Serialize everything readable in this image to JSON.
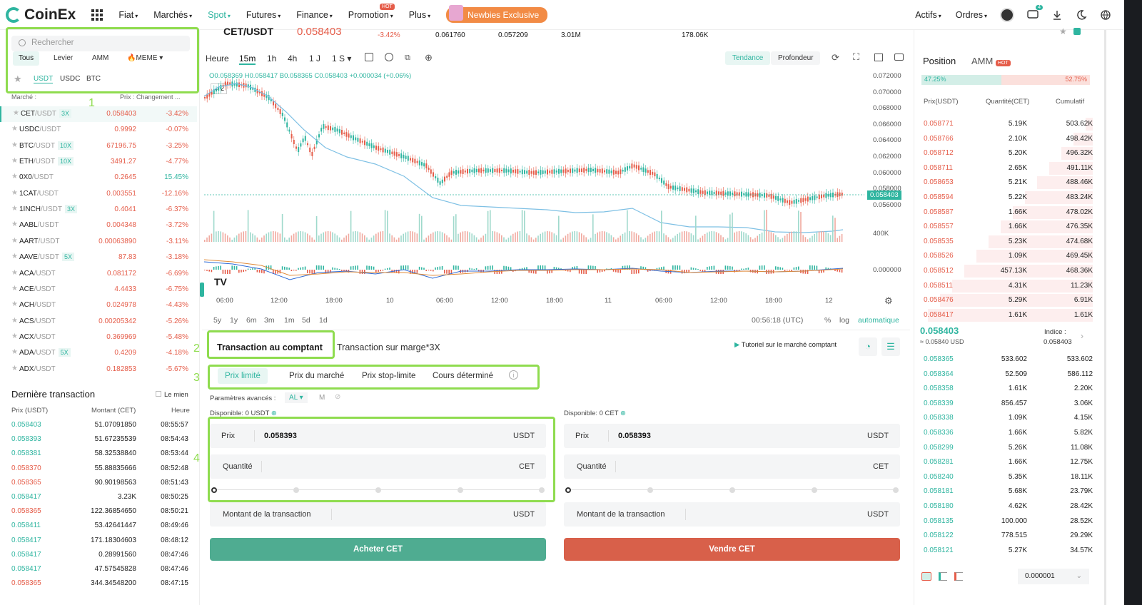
{
  "nav": {
    "brand": "CoinEx",
    "items": [
      "Fiat",
      "Marchés",
      "Spot",
      "Futures",
      "Finance",
      "Promotion",
      "Plus"
    ],
    "hot": "HOT",
    "newbie": "Newbies Exclusive",
    "actifs": "Actifs",
    "ordres": "Ordres",
    "msg_count": "4",
    "accent": "#2fb5a0"
  },
  "ticker": {
    "pair": "CET/USDT",
    "price": "0.058403",
    "change": "-3.42%",
    "high": "0.061760",
    "low": "0.057209",
    "vol": "3.01M",
    "amount": "178.06K"
  },
  "left": {
    "search_placeholder": "Rechercher",
    "filters": [
      "Tous",
      "Levier",
      "AMM",
      "MEME"
    ],
    "quotes": [
      "USDT",
      "USDC",
      "BTC"
    ],
    "col_market": "Marché :",
    "col_price": "Prix : Changement ...",
    "markets": [
      {
        "base": "CET",
        "quote": "/USDT",
        "lev": "3X",
        "price": "0.058403",
        "chg": "-3.42%",
        "neg": true
      },
      {
        "base": "USDC",
        "quote": "/USDT",
        "lev": "",
        "price": "0.9992",
        "chg": "-0.07%",
        "neg": true
      },
      {
        "base": "BTC",
        "quote": "/USDT",
        "lev": "10X",
        "price": "67196.75",
        "chg": "-3.25%",
        "neg": true
      },
      {
        "base": "ETH",
        "quote": "/USDT",
        "lev": "10X",
        "price": "3491.27",
        "chg": "-4.77%",
        "neg": true
      },
      {
        "base": "0X0",
        "quote": "/USDT",
        "lev": "",
        "price": "0.2645",
        "chg": "15.45%",
        "neg": false
      },
      {
        "base": "1CAT",
        "quote": "/USDT",
        "lev": "",
        "price": "0.003551",
        "chg": "-12.16%",
        "neg": true
      },
      {
        "base": "1INCH",
        "quote": "/USDT",
        "lev": "3X",
        "price": "0.4041",
        "chg": "-6.37%",
        "neg": true
      },
      {
        "base": "AABL",
        "quote": "/USDT",
        "lev": "",
        "price": "0.004348",
        "chg": "-3.72%",
        "neg": true
      },
      {
        "base": "AART",
        "quote": "/USDT",
        "lev": "",
        "price": "0.00063890",
        "chg": "-3.11%",
        "neg": true
      },
      {
        "base": "AAVE",
        "quote": "/USDT",
        "lev": "5X",
        "price": "87.83",
        "chg": "-3.18%",
        "neg": true
      },
      {
        "base": "ACA",
        "quote": "/USDT",
        "lev": "",
        "price": "0.081172",
        "chg": "-6.69%",
        "neg": true
      },
      {
        "base": "ACE",
        "quote": "/USDT",
        "lev": "",
        "price": "4.4433",
        "chg": "-6.75%",
        "neg": true
      },
      {
        "base": "ACH",
        "quote": "/USDT",
        "lev": "",
        "price": "0.024978",
        "chg": "-4.43%",
        "neg": true
      },
      {
        "base": "ACS",
        "quote": "/USDT",
        "lev": "",
        "price": "0.00205342",
        "chg": "-5.26%",
        "neg": true
      },
      {
        "base": "ACX",
        "quote": "/USDT",
        "lev": "",
        "price": "0.369969",
        "chg": "-5.48%",
        "neg": true
      },
      {
        "base": "ADA",
        "quote": "/USDT",
        "lev": "5X",
        "price": "0.4209",
        "chg": "-4.18%",
        "neg": true
      },
      {
        "base": "ADX",
        "quote": "/USDT",
        "lev": "",
        "price": "0.182853",
        "chg": "-5.67%",
        "neg": true
      }
    ],
    "last_title": "Dernière transaction",
    "mine": "Le mien",
    "th_price": "Prix (USDT)",
    "th_amount": "Montant (CET)",
    "th_time": "Heure",
    "trades": [
      {
        "p": "0.058403",
        "a": "51.07091850",
        "t": "08:55:57",
        "buy": true
      },
      {
        "p": "0.058393",
        "a": "51.67235539",
        "t": "08:54:43",
        "buy": true
      },
      {
        "p": "0.058381",
        "a": "58.32538840",
        "t": "08:53:44",
        "buy": true
      },
      {
        "p": "0.058370",
        "a": "55.88835666",
        "t": "08:52:48",
        "buy": false
      },
      {
        "p": "0.058365",
        "a": "90.90198563",
        "t": "08:51:43",
        "buy": false
      },
      {
        "p": "0.058417",
        "a": "3.23K",
        "t": "08:50:25",
        "buy": true
      },
      {
        "p": "0.058365",
        "a": "122.36854650",
        "t": "08:50:21",
        "buy": false
      },
      {
        "p": "0.058411",
        "a": "53.42641447",
        "t": "08:49:46",
        "buy": true
      },
      {
        "p": "0.058417",
        "a": "171.18304603",
        "t": "08:48:12",
        "buy": true
      },
      {
        "p": "0.058417",
        "a": "0.28991560",
        "t": "08:47:46",
        "buy": true
      },
      {
        "p": "0.058417",
        "a": "47.57545828",
        "t": "08:47:46",
        "buy": true
      },
      {
        "p": "0.058365",
        "a": "344.34548200",
        "t": "08:47:15",
        "buy": false
      }
    ]
  },
  "chart": {
    "intervals": [
      "Heure",
      "15m",
      "1h",
      "4h",
      "1 J",
      "1 S"
    ],
    "modes": [
      "Tendance",
      "Profondeur"
    ],
    "ohlc": "O0.058369 H0.058417 B0.058365 C0.058403 +0.000034 (+0.06%)",
    "collapse": "2",
    "ylabels": [
      "0.072000",
      "0.070000",
      "0.068000",
      "0.066000",
      "0.064000",
      "0.062000",
      "0.060000",
      "0.058000",
      "0.056000"
    ],
    "last": "0.058403",
    "vol_label": "400K",
    "macd_label": "0.000000",
    "xlabels": [
      "06:00",
      "12:00",
      "18:00",
      "10",
      "06:00",
      "12:00",
      "18:00",
      "11",
      "06:00",
      "12:00",
      "18:00",
      "12"
    ],
    "ranges": [
      "5y",
      "1y",
      "6m",
      "3m",
      "1m",
      "5d",
      "1d"
    ],
    "clock": "00:56:18 (UTC)",
    "pct": "%",
    "log": "log",
    "auto": "automatique"
  },
  "trade": {
    "tab_spot": "Transaction au comptant",
    "tab_margin": "Transaction sur marge*3X",
    "tutorial": "Tutoriel sur le marché comptant",
    "otypes": [
      "Prix limité",
      "Prix du marché",
      "Prix stop-limite",
      "Cours déterminé"
    ],
    "adv": "Paramètres avancés :",
    "al": "AL",
    "m": "M",
    "avail_buy": "Disponible: 0 USDT",
    "avail_sell": "Disponible: 0 CET",
    "prix": "Prix",
    "price_val": "0.058393",
    "usdt": "USDT",
    "cet": "CET",
    "qty": "Quantité",
    "montant": "Montant de la transaction",
    "buy_btn": "Acheter CET",
    "sell_btn": "Vendre CET",
    "buy_color": "#4fac91",
    "sell_color": "#d8604a"
  },
  "ob": {
    "tab_pos": "Position",
    "tab_amm": "AMM",
    "hot": "HOT",
    "buy_pct": "47.25%",
    "sell_pct": "52.75%",
    "h_price": "Prix(USDT)",
    "h_qty": "Quantité(CET)",
    "h_cum": "Cumulatif",
    "asks": [
      [
        "0.058771",
        "5.19K",
        "503.62K"
      ],
      [
        "0.058766",
        "2.10K",
        "498.42K"
      ],
      [
        "0.058712",
        "5.20K",
        "496.32K"
      ],
      [
        "0.058711",
        "2.65K",
        "491.11K"
      ],
      [
        "0.058653",
        "5.21K",
        "488.46K"
      ],
      [
        "0.058594",
        "5.22K",
        "483.24K"
      ],
      [
        "0.058587",
        "1.66K",
        "478.02K"
      ],
      [
        "0.058557",
        "1.66K",
        "476.35K"
      ],
      [
        "0.058535",
        "5.23K",
        "474.68K"
      ],
      [
        "0.058526",
        "1.09K",
        "469.45K"
      ],
      [
        "0.058512",
        "457.13K",
        "468.36K"
      ],
      [
        "0.058511",
        "4.31K",
        "11.23K"
      ],
      [
        "0.058476",
        "5.29K",
        "6.91K"
      ],
      [
        "0.058417",
        "1.61K",
        "1.61K"
      ]
    ],
    "mid": "0.058403",
    "mid_usd": "≈ 0.05840 USD",
    "indice": "Indice :",
    "indice_val": "0.058403",
    "bids": [
      [
        "0.058365",
        "533.602",
        "533.602"
      ],
      [
        "0.058364",
        "52.509",
        "586.112"
      ],
      [
        "0.058358",
        "1.61K",
        "2.20K"
      ],
      [
        "0.058339",
        "856.457",
        "3.06K"
      ],
      [
        "0.058338",
        "1.09K",
        "4.15K"
      ],
      [
        "0.058336",
        "1.66K",
        "5.82K"
      ],
      [
        "0.058299",
        "5.26K",
        "11.08K"
      ],
      [
        "0.058281",
        "1.66K",
        "12.75K"
      ],
      [
        "0.058240",
        "5.35K",
        "18.11K"
      ],
      [
        "0.058181",
        "5.68K",
        "23.79K"
      ],
      [
        "0.058180",
        "4.62K",
        "28.42K"
      ],
      [
        "0.058135",
        "100.000",
        "28.52K"
      ],
      [
        "0.058122",
        "778.515",
        "29.29K"
      ],
      [
        "0.058121",
        "5.27K",
        "34.57K"
      ]
    ],
    "precision": "0.000001"
  },
  "annotations": [
    "1",
    "2",
    "3",
    "4"
  ]
}
